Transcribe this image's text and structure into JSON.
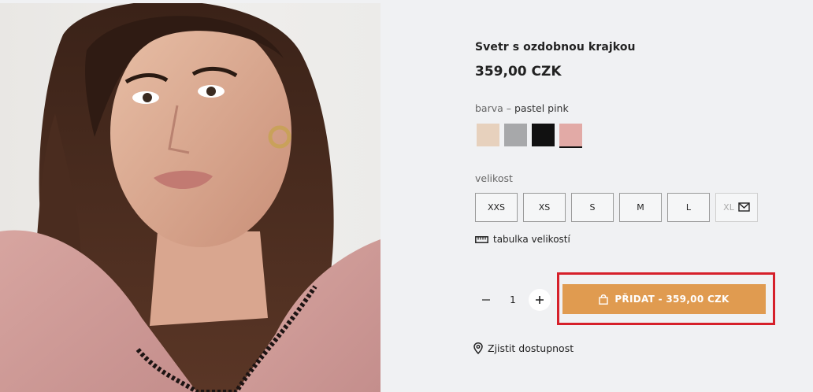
{
  "product": {
    "title": "Svetr s ozdobnou krajkou",
    "price": "359,00 CZK"
  },
  "color": {
    "label": "barva",
    "separator": " – ",
    "selected": "pastel pink",
    "swatches": [
      {
        "name": "beige",
        "hex": "#e7d1bd"
      },
      {
        "name": "grey",
        "hex": "#a7a8aa"
      },
      {
        "name": "black",
        "hex": "#111111"
      },
      {
        "name": "pastel pink",
        "hex": "#e2aaa6"
      }
    ]
  },
  "size": {
    "label": "velikost",
    "options": [
      "XXS",
      "XS",
      "S",
      "M",
      "L",
      "XL"
    ],
    "size_table_label": "tabulka velikostí"
  },
  "quantity": {
    "value": "1",
    "minus": "−",
    "plus": "+"
  },
  "cart": {
    "button_label": "PŘIDAT - 359,00 CZK",
    "button_color": "#e09b50",
    "highlight_color": "#d6202a"
  },
  "availability": {
    "label": "Zjistit dostupnost"
  }
}
